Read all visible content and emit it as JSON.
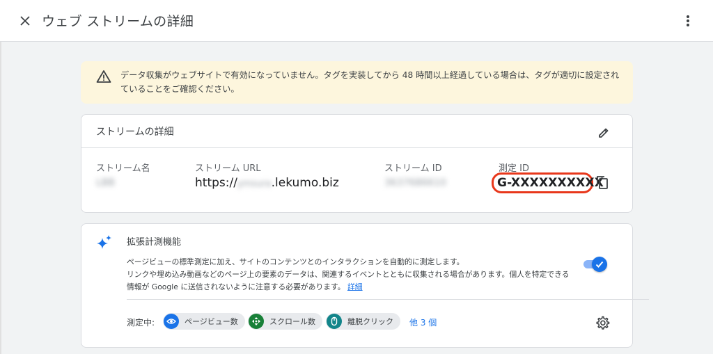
{
  "header": {
    "title": "ウェブ ストリームの詳細",
    "close_icon": "close-icon",
    "more_icon": "more-vert-icon"
  },
  "warning": {
    "icon": "warning-icon",
    "text": "データ収集がウェブサイトで有効になっていません。タグを実装してから 48 時間以上経過している場合は、タグが適切に設定されていることをご確認ください。"
  },
  "stream_details": {
    "title": "ストリームの詳細",
    "edit_icon": "edit-icon",
    "fields": {
      "name_label": "ストリーム名",
      "name_value": "LBB",
      "url_label": "ストリーム URL",
      "url_prefix": "https://",
      "url_blurred": "ymsura",
      "url_suffix": ".lekumo.biz",
      "id_label": "ストリーム ID",
      "id_value": "3637686610",
      "measurement_label": "測定 ID",
      "measurement_value": "G-XXXXXXXXXX"
    },
    "copy_icon": "copy-icon",
    "highlight_color": "#e8371b"
  },
  "enhanced": {
    "icon": "sparkle-icon",
    "title": "拡張計測機能",
    "desc_line1": "ページビューの標準測定に加え、サイトのコンテンツとのインタラクションを自動的に測定します。",
    "desc_line2": "リンクや埋め込み動画などのページ上の要素のデータは、関連するイベントとともに収集される場合があります。個人を特定できる",
    "desc_line3": "情報が Google に送信されないように注意する必要があります。",
    "desc_link": "詳細",
    "toggle_on": true,
    "measuring_label": "測定中:",
    "chips": [
      {
        "label": "ページビュー数",
        "icon": "eye-icon",
        "color": "#1a73e8"
      },
      {
        "label": "スクロール数",
        "icon": "scroll-icon",
        "color": "#188038"
      },
      {
        "label": "離脱クリック",
        "icon": "mouse-icon",
        "color": "#12858a"
      }
    ],
    "more_link": "他 3 個",
    "settings_icon": "gear-icon"
  }
}
